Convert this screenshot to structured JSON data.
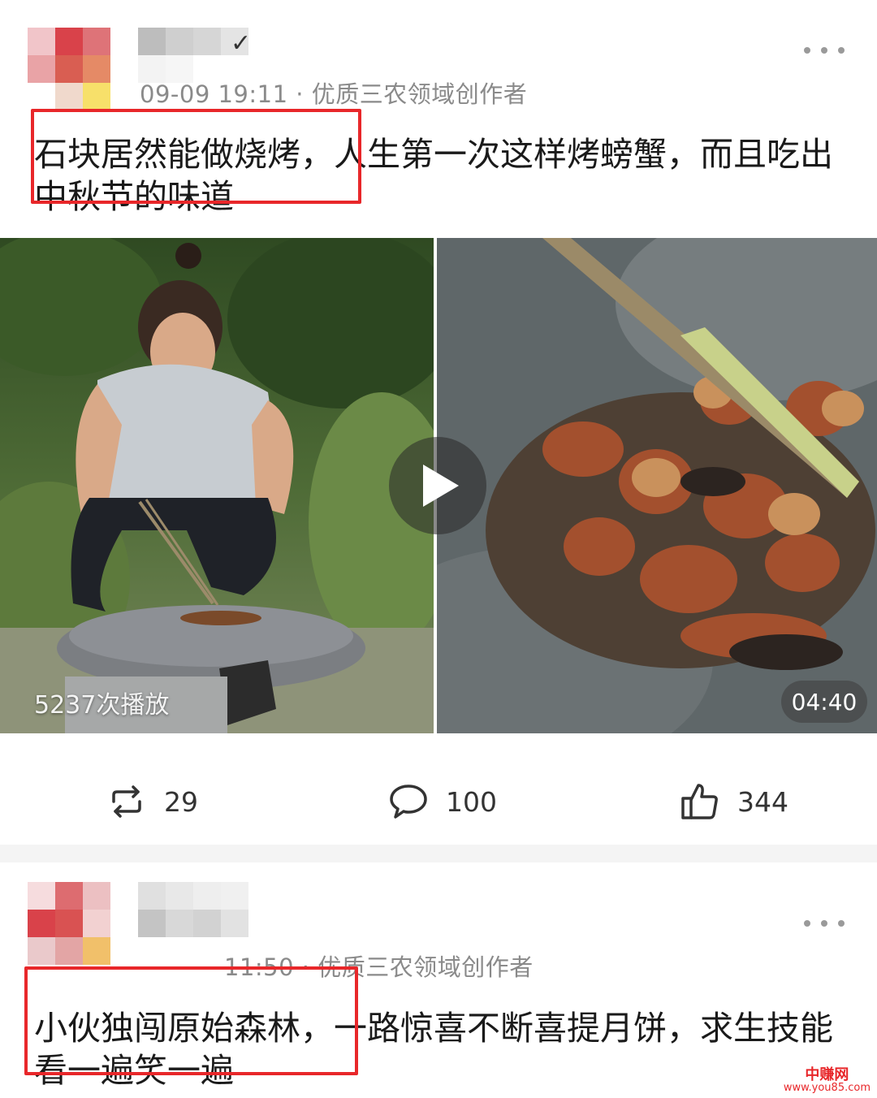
{
  "posts": [
    {
      "meta": "09-09 19:11 · 优质三农领域创作者",
      "title": "石块居然能做烧烤，人生第一次这样烤螃蟹，而且吃出中秋节的味道",
      "views": "5237次播放",
      "duration": "04:40",
      "reposts": "29",
      "comments": "100",
      "likes": "344"
    },
    {
      "meta": "11:50 · 优质三农领域创作者",
      "title": "小伙独闯原始森林，一路惊喜不断喜提月饼，求生技能看一遍笑一遍"
    }
  ],
  "icons": {
    "more": "more-dots-icon",
    "repost": "repost-icon",
    "comment": "comment-icon",
    "like": "thumbs-up-icon",
    "play": "play-icon"
  },
  "watermark": {
    "cn": "中赚网",
    "url": "www.you85.com"
  },
  "colors": {
    "highlight": "#e8272a",
    "meta": "#8a8a8a",
    "separator": "#f4f4f4"
  }
}
